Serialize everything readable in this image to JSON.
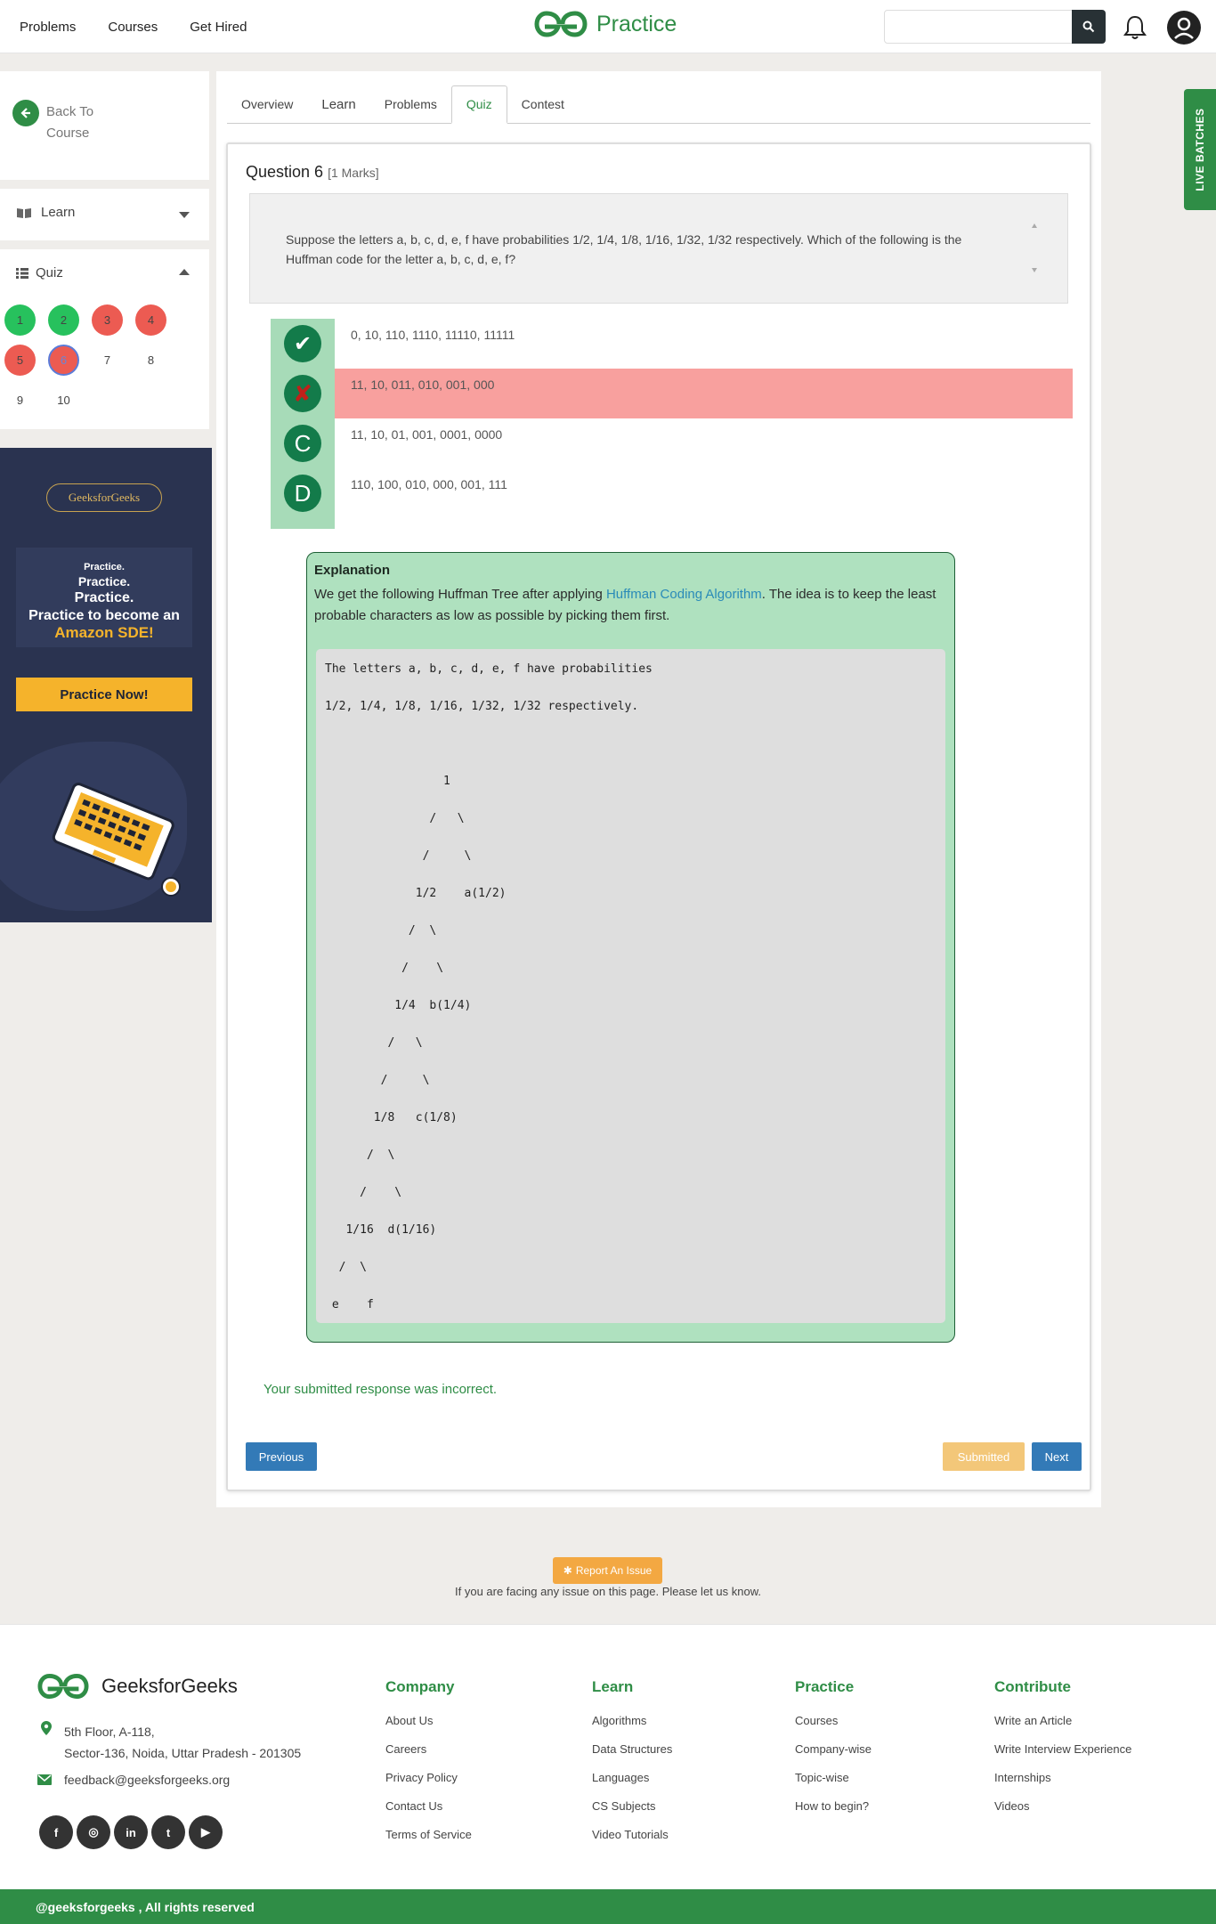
{
  "topbar": {
    "nav": [
      "Problems",
      "Courses",
      "Get Hired"
    ],
    "brand": "Practice",
    "search_placeholder": ""
  },
  "sidebar": {
    "back_label_1": "Back To",
    "back_label_2": "Course",
    "learn_label": "Learn",
    "quiz_label": "Quiz",
    "quiz_numbers": [
      {
        "n": "1",
        "status": "correct"
      },
      {
        "n": "2",
        "status": "correct"
      },
      {
        "n": "3",
        "status": "incorrect"
      },
      {
        "n": "4",
        "status": "incorrect"
      },
      {
        "n": "5",
        "status": "incorrect"
      },
      {
        "n": "6",
        "status": "current"
      },
      {
        "n": "7",
        "status": "unattempted"
      },
      {
        "n": "8",
        "status": "unattempted"
      },
      {
        "n": "9",
        "status": "unattempted"
      },
      {
        "n": "10",
        "status": "unattempted"
      }
    ]
  },
  "ad": {
    "pill": "GeeksforGeeks",
    "line1": "Practice.",
    "line2": "Practice.",
    "line3": "Practice.",
    "line4": "Practice to become an",
    "line5": "Amazon SDE!",
    "cta": "Practice Now!"
  },
  "live_batches": "LIVE BATCHES",
  "tabs": [
    "Overview",
    "Learn",
    "Problems",
    "Quiz",
    "Contest"
  ],
  "active_tab": "Quiz",
  "question": {
    "title": "Question 6",
    "marks": "[1 Marks]",
    "text": "Suppose the letters a, b, c, d, e, f have probabilities 1/2, 1/4, 1/8, 1/16, 1/32, 1/32 respectively. Which of the following is the Huffman code for the letter a, b, c, d, e, f?",
    "options": [
      {
        "badge": "✔",
        "text": "0, 10, 110, 1110, 11110, 11111",
        "state": "correct"
      },
      {
        "badge": "✘",
        "text": "11, 10, 011, 010, 001, 000",
        "state": "selected-wrong"
      },
      {
        "badge": "C",
        "text": "11, 10, 01, 001, 0001, 0000",
        "state": "normal"
      },
      {
        "badge": "D",
        "text": "110, 100, 010, 000, 001, 111",
        "state": "normal"
      }
    ]
  },
  "explanation": {
    "heading": "Explanation",
    "text_before": "We get the following Huffman Tree after applying ",
    "link": "Huffman Coding Algorithm",
    "text_after": ". The idea is to keep the least probable characters as low as possible by picking them first.",
    "code": "The letters a, b, c, d, e, f have probabilities\n\n1/2, 1/4, 1/8, 1/16, 1/32, 1/32 respectively.\n\n\n\n                 1\n\n               /   \\\n\n              /     \\\n\n             1/2    a(1/2)\n\n            /  \\\n\n           /    \\\n\n          1/4  b(1/4)\n\n         /   \\\n\n        /     \\\n\n       1/8   c(1/8)\n\n      /  \\\n\n     /    \\\n\n   1/16  d(1/16)\n\n  /  \\\n\n e    f"
  },
  "result_text": "Your submitted response was incorrect.",
  "buttons": {
    "previous": "Previous",
    "submitted": "Submitted",
    "next": "Next"
  },
  "report": {
    "label": "Report An Issue",
    "note": "If you are facing any issue on this page. Please let us know."
  },
  "footer": {
    "brand": "GeeksforGeeks",
    "address_1": "5th Floor, A-118,",
    "address_2": "Sector-136, Noida, Uttar Pradesh - 201305",
    "email": "feedback@geeksforgeeks.org",
    "columns": [
      {
        "title": "Company",
        "items": [
          "About Us",
          "Careers",
          "Privacy Policy",
          "Contact Us",
          "Terms of Service"
        ]
      },
      {
        "title": "Learn",
        "items": [
          "Algorithms",
          "Data Structures",
          "Languages",
          "CS Subjects",
          "Video Tutorials"
        ]
      },
      {
        "title": "Practice",
        "items": [
          "Courses",
          "Company-wise",
          "Topic-wise",
          "How to begin?"
        ]
      },
      {
        "title": "Contribute",
        "items": [
          "Write an Article",
          "Write Interview Experience",
          "Internships",
          "Videos"
        ]
      }
    ],
    "social": [
      "facebook-icon",
      "instagram-icon",
      "linkedin-icon",
      "twitter-icon",
      "youtube-icon"
    ],
    "copyright": "@geeksforgeeks , All rights reserved"
  },
  "colors": {
    "brand_green": "#2f8d46",
    "correct": "#27c15d",
    "incorrect": "#ec5b52",
    "wrong_row": "#f8a09e",
    "button_blue": "#337ab7"
  }
}
